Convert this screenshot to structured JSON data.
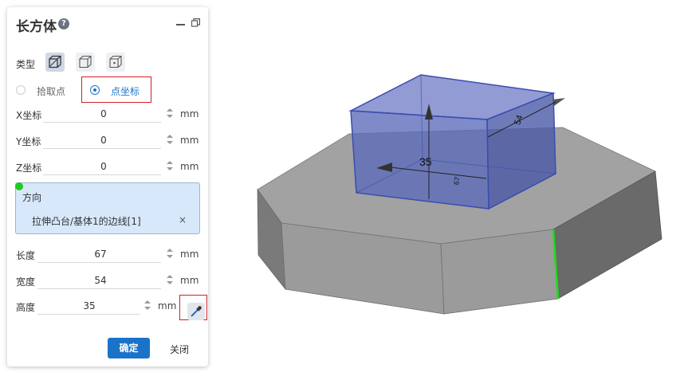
{
  "panel": {
    "title": "长方体",
    "type_label": "类型",
    "mode": {
      "pick_point_label": "拾取点",
      "point_coord_label": "点坐标",
      "selected": "点坐标"
    },
    "coords": [
      {
        "label": "X坐标",
        "value": "0",
        "unit": "mm"
      },
      {
        "label": "Y坐标",
        "value": "0",
        "unit": "mm"
      },
      {
        "label": "Z坐标",
        "value": "0",
        "unit": "mm"
      }
    ],
    "direction": {
      "title": "方向",
      "item": "拉伸凸台/基体1的边线[1]",
      "remove": "×"
    },
    "dims": [
      {
        "label": "长度",
        "value": "67",
        "unit": "mm"
      },
      {
        "label": "宽度",
        "value": "54",
        "unit": "mm"
      },
      {
        "label": "高度",
        "value": "35",
        "unit": "mm"
      }
    ],
    "ok_label": "确定",
    "close_label": "关闭"
  },
  "viewport": {
    "dim_height": "35",
    "dim_width": "54",
    "dim_length": "67",
    "colors": {
      "box_fill": "#5a6ab8",
      "box_edge": "#3a4db0",
      "base_top": "#a2a2a2",
      "base_front": "#9a9a9a",
      "base_side": "#6a6a6a",
      "selected_edge": "#19e019"
    }
  }
}
